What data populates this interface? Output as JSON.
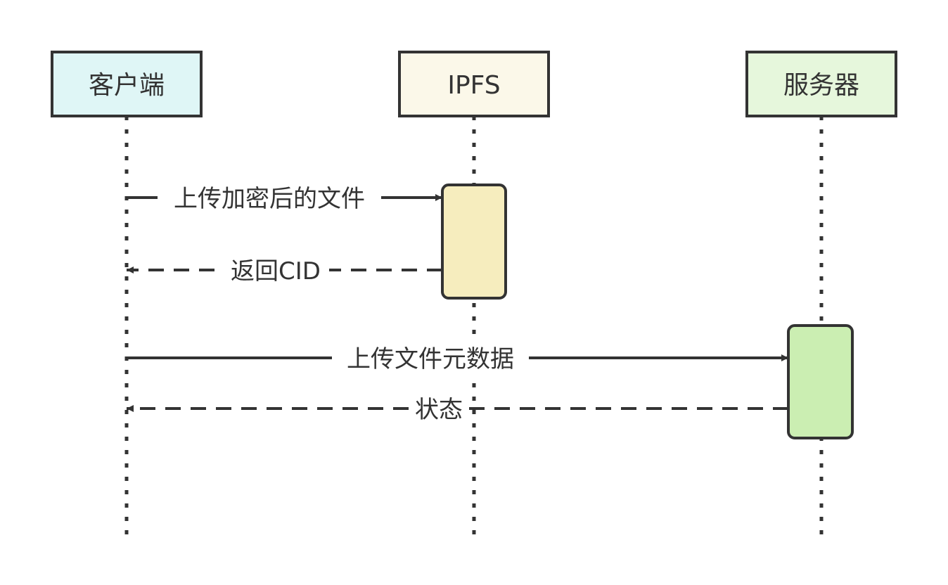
{
  "participants": [
    {
      "id": "client",
      "label": "客户端",
      "fill": "#dff6f6"
    },
    {
      "id": "ipfs",
      "label": "IPFS",
      "fill": "#fbf8e9"
    },
    {
      "id": "server",
      "label": "服务器",
      "fill": "#e6f7dc"
    }
  ],
  "activations": [
    {
      "participant": "ipfs",
      "fill": "#f6edbe"
    },
    {
      "participant": "server",
      "fill": "#cbeeb2"
    }
  ],
  "messages": [
    {
      "label": "上传加密后的文件",
      "from": "client",
      "to": "ipfs",
      "style": "solid"
    },
    {
      "label": "返回CID",
      "from": "ipfs",
      "to": "client",
      "style": "dashed"
    },
    {
      "label": "上传文件元数据",
      "from": "client",
      "to": "server",
      "style": "solid"
    },
    {
      "label": "状态",
      "from": "server",
      "to": "client",
      "style": "dashed"
    }
  ],
  "colors": {
    "stroke": "#333333",
    "background": "#ffffff"
  }
}
